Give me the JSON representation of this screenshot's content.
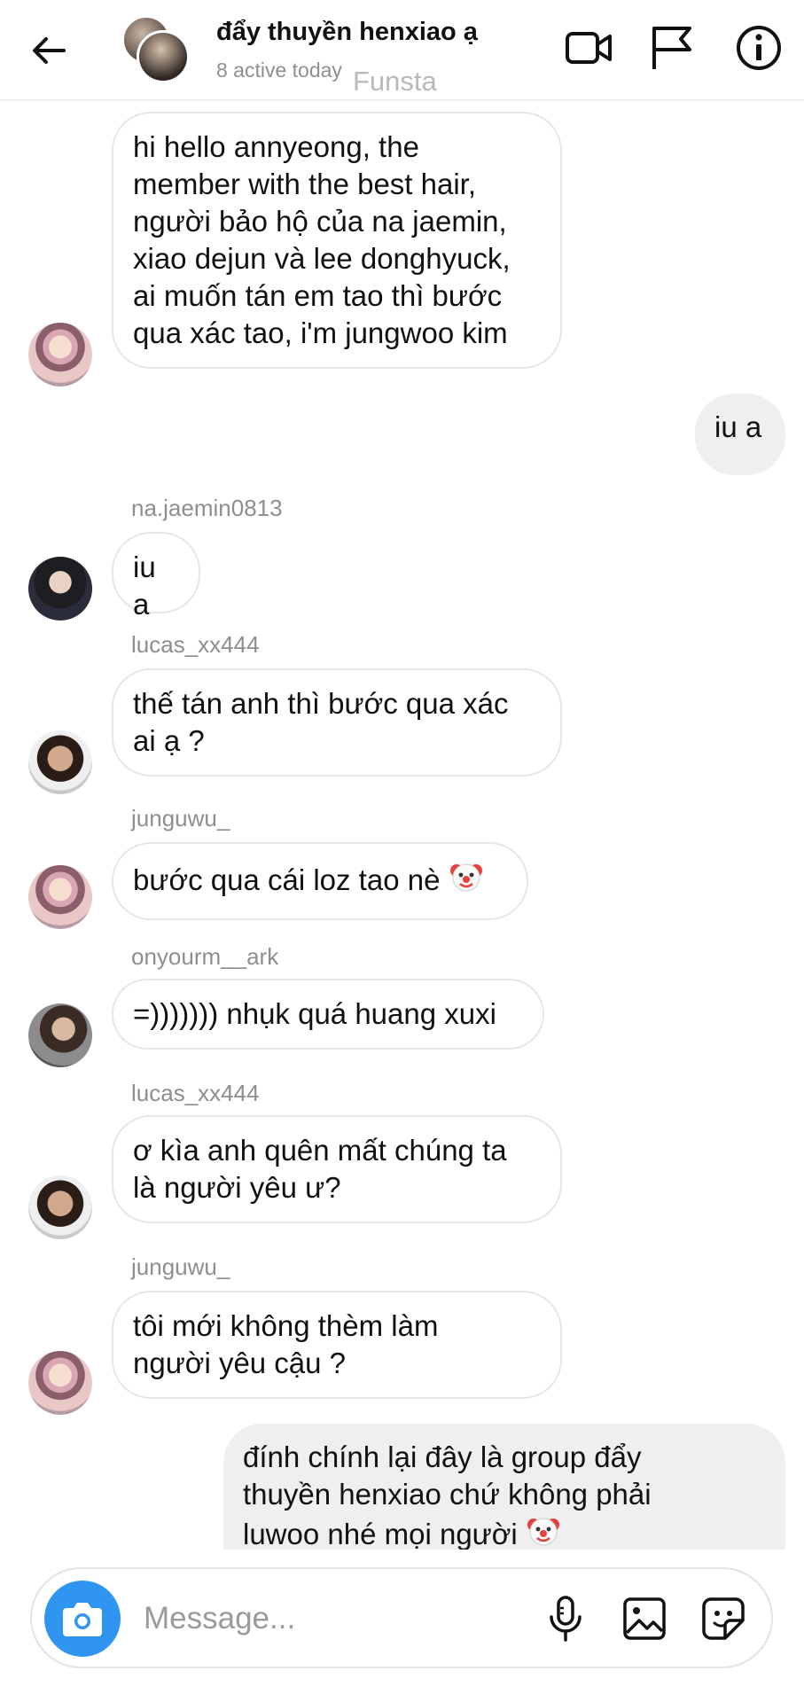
{
  "header": {
    "title": "đẩy thuyền henxiao ạ",
    "status": "8 active today",
    "watermark": "Funsta"
  },
  "messages": [
    {
      "sender": "",
      "direction": "in",
      "avatar": "jungwoo",
      "text": "hi hello annyeong, the\nmember with the best hair,\nngười bảo hộ của na jaemin,\nxiao dejun và lee donghyuck,\nai muốn tán em tao thì bước\nqua xác tao, i'm jungwoo kim"
    },
    {
      "direction": "out",
      "text": "iu a"
    },
    {
      "sender": "na.jaemin0813",
      "direction": "in",
      "avatar": "jaemin",
      "text": "iu a"
    },
    {
      "sender": "lucas_xx444",
      "direction": "in",
      "avatar": "lucas",
      "text": "thế tán anh thì bước qua xác\nai ạ ?"
    },
    {
      "sender": "junguwu_",
      "direction": "in",
      "avatar": "jungwoo",
      "text": "bước qua cái loz tao nè",
      "emoji": "clown-face"
    },
    {
      "sender": "onyourm__ark",
      "direction": "in",
      "avatar": "mark",
      "text": "=))))))) nhụk quá huang xuxi"
    },
    {
      "sender": "lucas_xx444",
      "direction": "in",
      "avatar": "lucas",
      "text": "ơ kìa anh quên mất chúng ta\nlà người yêu ư?"
    },
    {
      "sender": "junguwu_",
      "direction": "in",
      "avatar": "jungwoo",
      "text": "tôi mới không thèm làm\nngười yêu cậu ?"
    },
    {
      "direction": "out",
      "text": "đính chính lại đây là group đẩy\nthuyền henxiao chứ không phải\nluwoo nhé mọi người",
      "emoji": "clown-face"
    }
  ],
  "composer": {
    "placeholder": "Message...",
    "icons": [
      "camera-icon",
      "microphone-icon",
      "gallery-icon",
      "sticker-icon"
    ],
    "camera_color": "#2f95f1"
  },
  "colors": {
    "incoming_border": "#e6e6e6",
    "outgoing_bg": "#efefef",
    "secondary_text": "#8e8e8e"
  }
}
